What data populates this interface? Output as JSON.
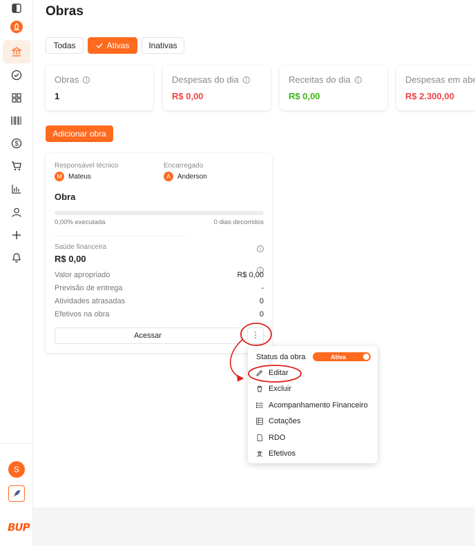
{
  "page": {
    "title": "Obras"
  },
  "filters": [
    {
      "label": "Todas",
      "active": false
    },
    {
      "label": "Ativas",
      "active": true
    },
    {
      "label": "Inativas",
      "active": false
    }
  ],
  "stats": [
    {
      "title": "Obras",
      "value": "1",
      "color": "#222222"
    },
    {
      "title": "Despesas do dia",
      "value": "R$ 0,00",
      "color": "#ef4444"
    },
    {
      "title": "Receitas do dia",
      "value": "R$ 0,00",
      "color": "#3fb618"
    },
    {
      "title": "Despesas em aberto",
      "value": "R$ 2.300,00",
      "color": "#ef4444"
    }
  ],
  "add_button": "Adicionar obra",
  "card": {
    "tech_label": "Responsável técnico",
    "tech_name": "Mateus",
    "tech_initial": "M",
    "foreman_label": "Encarregado",
    "foreman_name": "Anderson",
    "foreman_initial": "A",
    "title": "Obra",
    "progress_percent": 0,
    "executed": "0,00% executada",
    "days": "0 dias decorridos",
    "health_label": "Saúde financeira",
    "health_value": "R$ 0,00",
    "rows": [
      {
        "label": "Valor apropriado",
        "value": "R$ 0,00"
      },
      {
        "label": "Previsão de entrega",
        "value": "-"
      },
      {
        "label": "Atividades atrasadas",
        "value": "0"
      },
      {
        "label": "Efetivos na obra",
        "value": "0"
      }
    ],
    "access_button": "Acessar"
  },
  "menu": {
    "status_label": "Status da obra",
    "status_value": "Ativa",
    "items": [
      {
        "label": "Editar",
        "icon": "pencil-icon"
      },
      {
        "label": "Excluir",
        "icon": "trash-icon"
      },
      {
        "label": "Acompanhamento Financeiro",
        "icon": "list-icon"
      },
      {
        "label": "Cotações",
        "icon": "table-icon"
      },
      {
        "label": "RDO",
        "icon": "document-icon"
      },
      {
        "label": "Efetivos",
        "icon": "worker-icon"
      }
    ]
  },
  "sidebar": {
    "icons": [
      "panel-toggle-icon",
      "brand-flame-icon",
      "bank-icon",
      "check-circle-icon",
      "grid-icon",
      "barcode-icon",
      "dollar-icon",
      "cart-icon",
      "chart-icon",
      "user-icon",
      "plus-icon",
      "bell-icon"
    ],
    "avatar_initial": "S",
    "logo": "BUP"
  },
  "colors": {
    "accent": "#ff6a1f",
    "negative": "#ef4444",
    "positive": "#3fb618",
    "annotation": "#e0201a"
  }
}
